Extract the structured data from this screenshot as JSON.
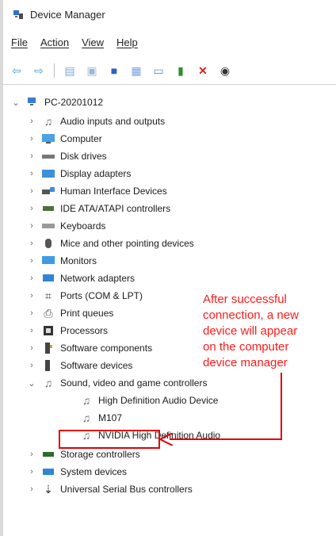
{
  "window": {
    "title": "Device Manager",
    "title_icon": "device-manager-icon"
  },
  "menu": {
    "items": [
      "File",
      "Action",
      "View",
      "Help"
    ]
  },
  "toolbar": {
    "buttons": [
      {
        "name": "back-icon",
        "glyph": "⇦"
      },
      {
        "name": "forward-icon",
        "glyph": "⇨"
      },
      {
        "name": "properties-icon",
        "glyph": "▤"
      },
      {
        "name": "help-pane-icon",
        "glyph": "▣"
      },
      {
        "name": "help-icon",
        "glyph": "■"
      },
      {
        "name": "scan-hardware-icon",
        "glyph": "▦"
      },
      {
        "name": "monitor-icon",
        "glyph": "▭"
      },
      {
        "name": "update-driver-icon",
        "glyph": "▮"
      },
      {
        "name": "uninstall-icon",
        "glyph": "✕"
      },
      {
        "name": "download-icon",
        "glyph": "◉"
      }
    ]
  },
  "tree": {
    "root": "PC-20201012",
    "items": [
      "Audio inputs and outputs",
      "Computer",
      "Disk drives",
      "Display adapters",
      "Human Interface Devices",
      "IDE ATA/ATAPI controllers",
      "Keyboards",
      "Mice and other pointing devices",
      "Monitors",
      "Network adapters",
      "Ports (COM & LPT)",
      "Print queues",
      "Processors",
      "Software components",
      "Software devices",
      "Sound, video and game controllers",
      "High Definition Audio Device",
      "M107",
      "NVIDIA High Definition Audio",
      "Storage controllers",
      "System devices",
      "Universal Serial Bus controllers"
    ]
  },
  "annotation": {
    "lines": [
      "After successful",
      "connection, a new",
      "device will appear",
      "on the computer",
      "device manager"
    ],
    "color": "#ff1a1a"
  }
}
